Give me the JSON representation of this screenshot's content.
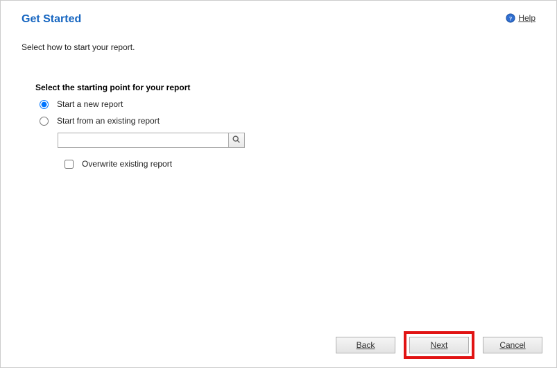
{
  "header": {
    "title": "Get Started",
    "help_label": "Help"
  },
  "instruction": "Select how to start your report.",
  "section": {
    "heading": "Select the starting point for your report",
    "options": {
      "new_report": "Start a new report",
      "existing_report": "Start from an existing report"
    },
    "existing_input_value": "",
    "existing_input_placeholder": "",
    "overwrite_label": "Overwrite existing report"
  },
  "footer": {
    "back": "Back",
    "next": "Next",
    "cancel": "Cancel"
  }
}
